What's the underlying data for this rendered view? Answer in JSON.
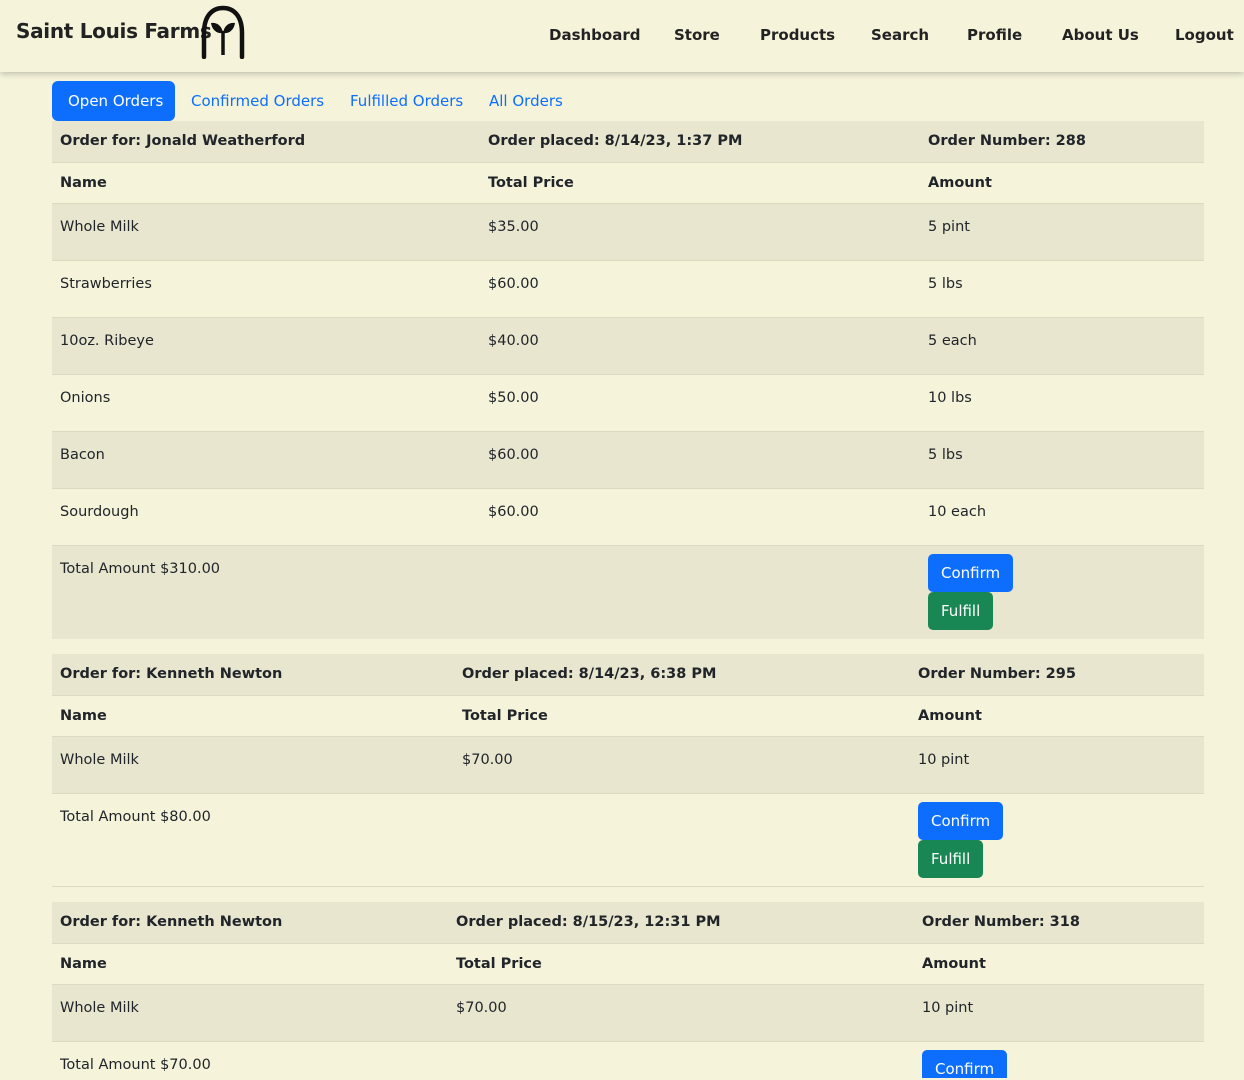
{
  "brand": {
    "name": "Saint Louis Farms"
  },
  "nav": [
    "Dashboard",
    "Store",
    "Products",
    "Search",
    "Profile",
    "About Us",
    "Logout"
  ],
  "tabs": [
    {
      "label": "Open Orders",
      "active": true
    },
    {
      "label": "Confirmed Orders"
    },
    {
      "label": "Fulfilled Orders"
    },
    {
      "label": "All Orders"
    }
  ],
  "labels": {
    "name": "Name",
    "total_price": "Total Price",
    "amount": "Amount",
    "confirm": "Confirm",
    "fulfill": "Fulfill"
  },
  "orders": [
    {
      "customer": "Order for: Jonald Weatherford",
      "placed": "Order placed: 8/14/23, 1:37 PM",
      "number": "Order Number: 288",
      "items": [
        {
          "name": "Whole Milk",
          "price": "$35.00",
          "amount": "5 pint"
        },
        {
          "name": "Strawberries",
          "price": "$60.00",
          "amount": "5 lbs"
        },
        {
          "name": "10oz. Ribeye",
          "price": "$40.00",
          "amount": "5 each"
        },
        {
          "name": "Onions",
          "price": "$50.00",
          "amount": "10 lbs"
        },
        {
          "name": "Bacon",
          "price": "$60.00",
          "amount": "5 lbs"
        },
        {
          "name": "Sourdough",
          "price": "$60.00",
          "amount": "10 each"
        }
      ],
      "total": "Total Amount $310.00"
    },
    {
      "customer": "Order for: Kenneth Newton",
      "placed": "Order placed: 8/14/23, 6:38 PM",
      "number": "Order Number: 295",
      "items": [
        {
          "name": "Whole Milk",
          "price": "$70.00",
          "amount": "10 pint"
        }
      ],
      "total": "Total Amount $80.00"
    },
    {
      "customer": "Order for: Kenneth Newton",
      "placed": "Order placed: 8/15/23, 12:31 PM",
      "number": "Order Number: 318",
      "items": [
        {
          "name": "Whole Milk",
          "price": "$70.00",
          "amount": "10 pint"
        }
      ],
      "total": "Total Amount $70.00"
    }
  ]
}
